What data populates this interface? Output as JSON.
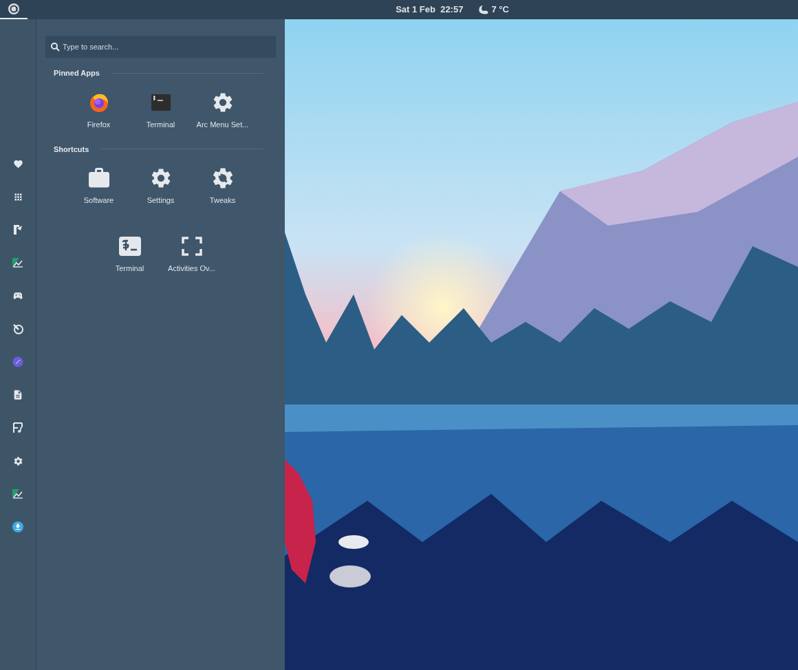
{
  "top_bar": {
    "date_time": "Sat 1 Feb  22:57",
    "weather": "7 °C"
  },
  "menu": {
    "search": {
      "placeholder": "Type to search..."
    },
    "sections": [
      {
        "title": "Pinned Apps",
        "apps": [
          {
            "label": "Firefox",
            "kind": "firefox"
          },
          {
            "label": "Terminal",
            "kind": "terminal"
          },
          {
            "label": "Arc Menu Set...",
            "kind": "gear"
          }
        ]
      },
      {
        "title": "Shortcuts",
        "apps": [
          {
            "label": "Software",
            "kind": "briefcase"
          },
          {
            "label": "Settings",
            "kind": "gear"
          },
          {
            "label": "Tweaks",
            "kind": "tweaks"
          },
          {
            "label": "Terminal",
            "kind": "terminal-light"
          },
          {
            "label": "Activities Ov...",
            "kind": "fullscreen"
          }
        ]
      }
    ]
  }
}
